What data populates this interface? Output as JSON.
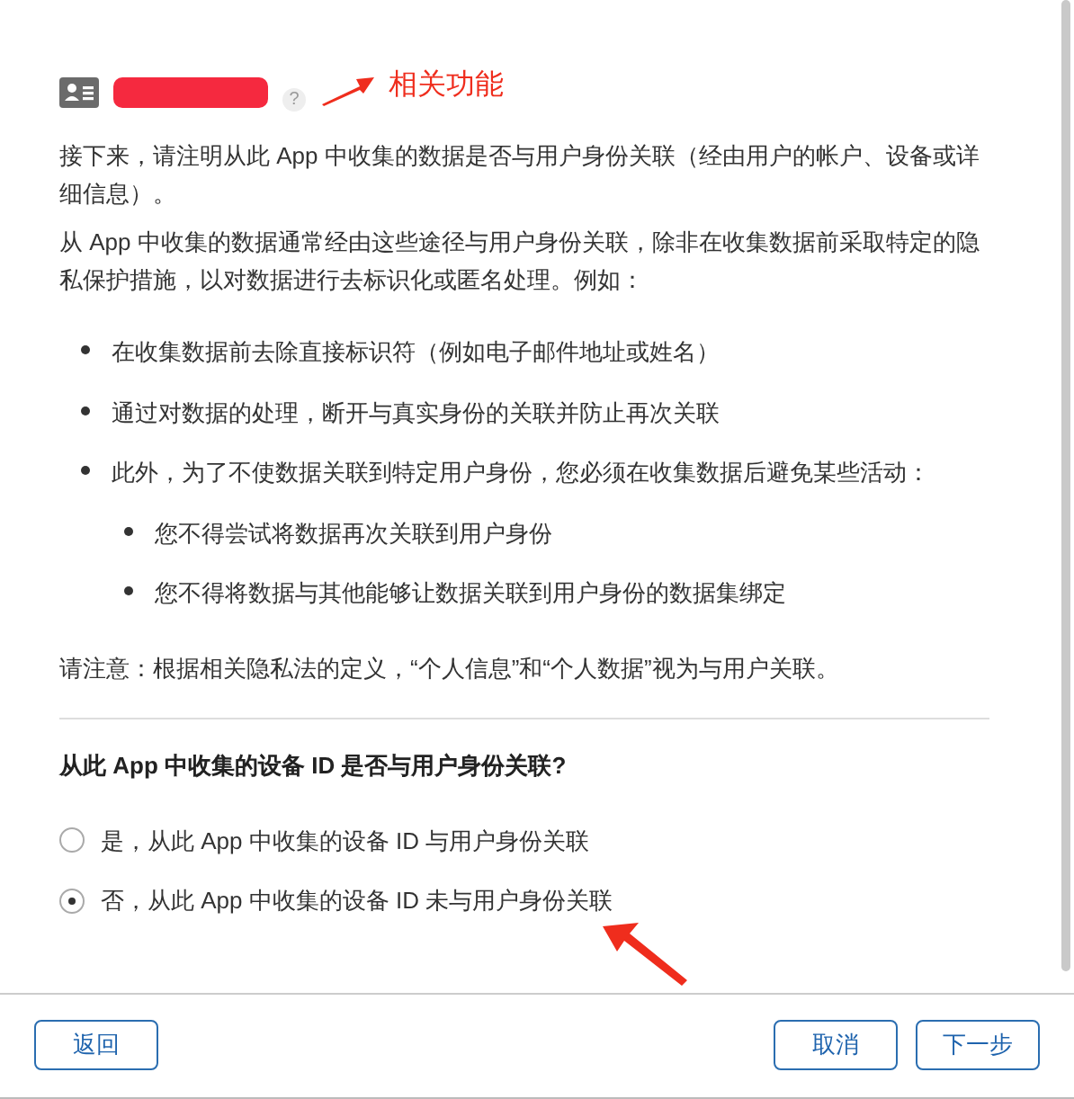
{
  "header": {
    "help": "?",
    "annotation": "相关功能"
  },
  "intro": "接下来，请注明从此 App 中收集的数据是否与用户身份关联（经由用户的帐户、设备或详细信息）。",
  "explanation": "从 App 中收集的数据通常经由这些途径与用户身份关联，除非在收集数据前采取特定的隐私保护措施，以对数据进行去标识化或匿名处理。例如：",
  "bullets": [
    {
      "text": "在收集数据前去除直接标识符（例如电子邮件地址或姓名）"
    },
    {
      "text": "通过对数据的处理，断开与真实身份的关联并防止再次关联"
    },
    {
      "text": "此外，为了不使数据关联到特定用户身份，您必须在收集数据后避免某些活动：",
      "children": [
        {
          "text": "您不得尝试将数据再次关联到用户身份"
        },
        {
          "text": "您不得将数据与其他能够让数据关联到用户身份的数据集绑定"
        }
      ]
    }
  ],
  "note": "请注意：根据相关隐私法的定义，“个人信息”和“个人数据”视为与用户关联。",
  "question": "从此 App 中收集的设备 ID 是否与用户身份关联?",
  "options": [
    {
      "label": "是，从此 App 中收集的设备 ID 与用户身份关联",
      "selected": false
    },
    {
      "label": "否，从此 App 中收集的设备 ID 未与用户身份关联",
      "selected": true
    }
  ],
  "buttons": {
    "back": "返回",
    "cancel": "取消",
    "next": "下一步"
  }
}
